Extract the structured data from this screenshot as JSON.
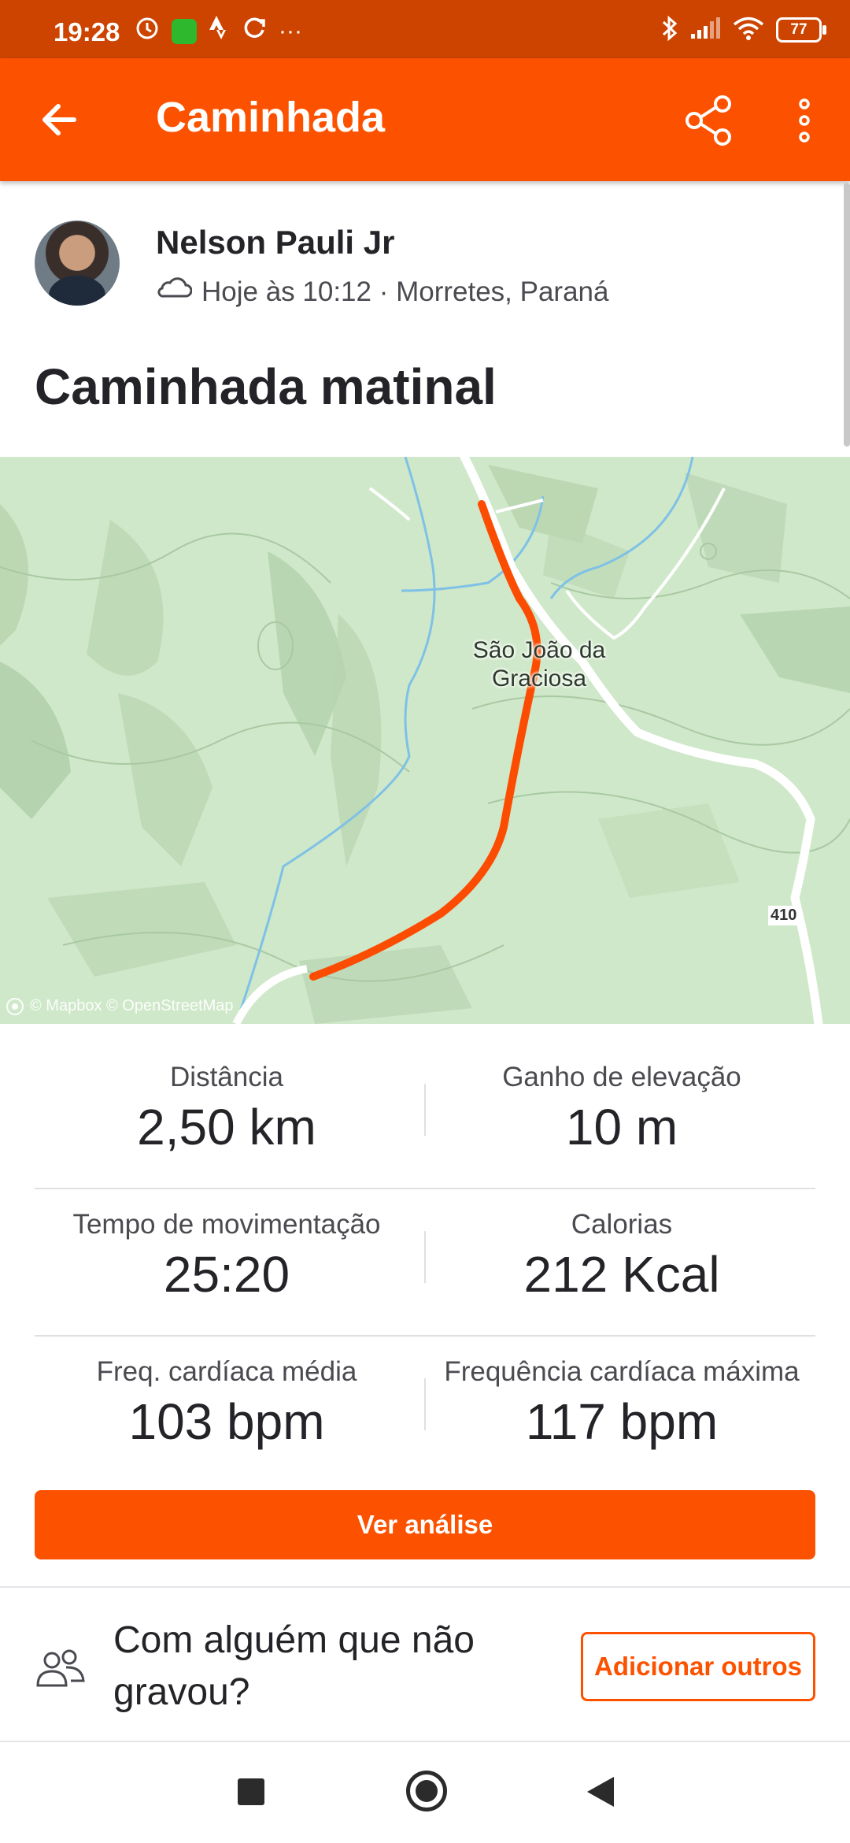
{
  "status_bar": {
    "time": "19:28",
    "left_icons": [
      "alarm-icon",
      "app-notification-icon",
      "strava-icon",
      "sync-icon",
      "more-dots-icon"
    ],
    "more_dots": "···",
    "battery": "77",
    "right_icons": [
      "bluetooth-icon",
      "signal-icon",
      "wifi-icon",
      "battery-icon"
    ]
  },
  "app_bar": {
    "title": "Caminhada",
    "icons": [
      "back-arrow-icon",
      "share-icon",
      "more-vert-icon"
    ]
  },
  "athlete": {
    "name": "Nelson Pauli Jr",
    "weather_icon": "cloud-icon",
    "meta": "Hoje às 10:12 · Morretes, Paraná"
  },
  "activity": {
    "title": "Caminhada matinal"
  },
  "map": {
    "place_label_line1": "São João da",
    "place_label_line2": "Graciosa",
    "road_number": "410",
    "attribution": "© Mapbox © OpenStreetMap",
    "route_color": "#fc4c02",
    "land_color": "#cfe8c9"
  },
  "stats": {
    "distance": {
      "label": "Distância",
      "value": "2,50 km"
    },
    "elevation_gain": {
      "label": "Ganho de elevação",
      "value": "10 m"
    },
    "moving_time": {
      "label": "Tempo de movimentação",
      "value": "25:20"
    },
    "calories": {
      "label": "Calorias",
      "value": "212 Kcal"
    },
    "avg_heart_rate": {
      "label": "Freq. cardíaca média",
      "value": "103 bpm"
    },
    "max_heart_rate": {
      "label": "Frequência cardíaca máxima",
      "value": "117 bpm"
    }
  },
  "analysis_button": {
    "label": "Ver análise"
  },
  "group_prompt": {
    "text": "Com alguém que não gravou?",
    "button_label": "Adicionar outros"
  },
  "colors": {
    "brand_orange": "#fc5200",
    "status_bar": "#cc4400"
  }
}
